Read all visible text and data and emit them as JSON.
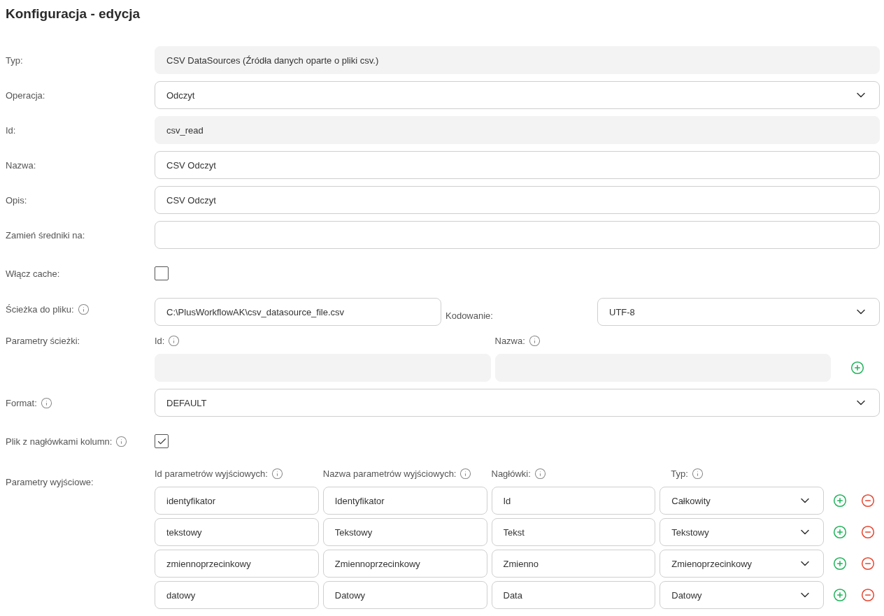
{
  "title": "Konfiguracja - edycja",
  "fields": [
    {
      "kind": "readonly",
      "label": "Typ:",
      "info": false,
      "value": "CSV DataSources (Źródła danych oparte o pliki csv.)"
    },
    {
      "kind": "select",
      "label": "Operacja:",
      "info": false,
      "value": "Odczyt"
    },
    {
      "kind": "readonly",
      "label": "Id:",
      "info": false,
      "value": "csv_read"
    },
    {
      "kind": "text",
      "label": "Nazwa:",
      "info": false,
      "value": "CSV Odczyt"
    },
    {
      "kind": "text",
      "label": "Opis:",
      "info": false,
      "value": "CSV Odczyt"
    },
    {
      "kind": "text",
      "label": "Zamień średniki na:",
      "info": false
    },
    {
      "kind": "checkbox",
      "label": "Włącz cache:",
      "info": false,
      "checked": false
    },
    {
      "kind": "path",
      "label": "Ścieżka do pliku:",
      "info": true,
      "value": "C:\\PlusWorkflowAK\\csv_datasource_file.csv",
      "encoding_label": "Kodowanie:",
      "encoding_value": "UTF-8"
    },
    {
      "kind": "pairs",
      "label": "Parametry ścieżki:",
      "info": false,
      "columns": [
        {
          "label": "Id:",
          "info": true
        },
        {
          "label": "Nazwa:",
          "info": true
        }
      ]
    },
    {
      "kind": "select",
      "label": "Format:",
      "info": true,
      "value": "DEFAULT"
    },
    {
      "kind": "checkbox",
      "label": "Plik z nagłówkami kolumn:",
      "info": true,
      "checked": true
    },
    {
      "kind": "outputs",
      "label": "Parametry wyjściowe:",
      "info": false,
      "columns": [
        {
          "label": "Id parametrów wyjściowych:",
          "info": true
        },
        {
          "label": "Nazwa parametrów wyjściowych:",
          "info": true
        },
        {
          "label": "Nagłówki:",
          "info": true
        },
        {
          "label": "Typ:",
          "info": true
        }
      ],
      "rows": [
        {
          "id": "identyfikator",
          "name": "Identyfikator",
          "header": "Id",
          "type": "Całkowity"
        },
        {
          "id": "tekstowy",
          "name": "Tekstowy",
          "header": "Tekst",
          "type": "Tekstowy"
        },
        {
          "id": "zmiennoprzecinkowy",
          "name": "Zmiennoprzecinkowy",
          "header": "Zmienno",
          "type": "Zmienoprzecinkowy"
        },
        {
          "id": "datowy",
          "name": "Datowy",
          "header": "Data",
          "type": "Datowy"
        }
      ]
    }
  ]
}
